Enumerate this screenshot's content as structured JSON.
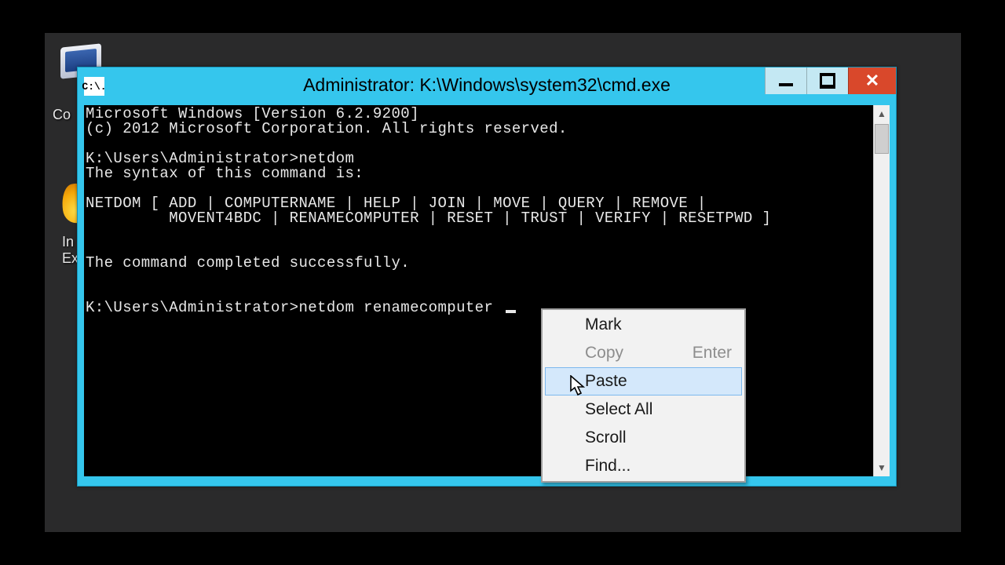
{
  "window": {
    "title": "Administrator: K:\\Windows\\system32\\cmd.exe",
    "sys_icon_text": "C:\\."
  },
  "desktop": {
    "icon1_label": "Co",
    "icon2_label_a": "In",
    "icon2_label_b": "Ex"
  },
  "terminal": {
    "lines": [
      "Microsoft Windows [Version 6.2.9200]",
      "(c) 2012 Microsoft Corporation. All rights reserved.",
      "",
      "K:\\Users\\Administrator>netdom",
      "The syntax of this command is:",
      "",
      "NETDOM [ ADD | COMPUTERNAME | HELP | JOIN | MOVE | QUERY | REMOVE |",
      "         MOVENT4BDC | RENAMECOMPUTER | RESET | TRUST | VERIFY | RESETPWD ]",
      "",
      "",
      "The command completed successfully.",
      "",
      "",
      "K:\\Users\\Administrator>netdom renamecomputer "
    ]
  },
  "context_menu": {
    "items": [
      {
        "label": "Mark",
        "shortcut": "",
        "disabled": false,
        "hover": false
      },
      {
        "label": "Copy",
        "shortcut": "Enter",
        "disabled": true,
        "hover": false
      },
      {
        "label": "Paste",
        "shortcut": "",
        "disabled": false,
        "hover": true
      },
      {
        "label": "Select All",
        "shortcut": "",
        "disabled": false,
        "hover": false
      },
      {
        "label": "Scroll",
        "shortcut": "",
        "disabled": false,
        "hover": false
      },
      {
        "label": "Find...",
        "shortcut": "",
        "disabled": false,
        "hover": false
      }
    ]
  },
  "scrollbar": {
    "up_glyph": "▲",
    "down_glyph": "▼"
  }
}
